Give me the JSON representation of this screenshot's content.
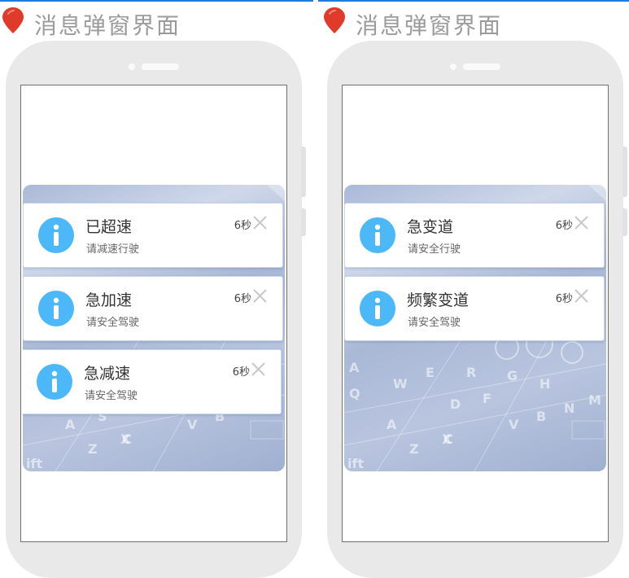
{
  "panels": [
    {
      "title": "消息弹窗界面",
      "notifications": [
        {
          "title": "已超速",
          "message": "请减速行驶",
          "timer": "6秒"
        },
        {
          "title": "急加速",
          "message": "请安全驾驶",
          "timer": "6秒"
        },
        {
          "title": "急减速",
          "message": "请安全驾驶",
          "timer": "6秒"
        }
      ]
    },
    {
      "title": "消息弹窗界面",
      "notifications": [
        {
          "title": "急变道",
          "message": "请安全行驶",
          "timer": "6秒"
        },
        {
          "title": "频繁变道",
          "message": "请安全驾驶",
          "timer": "6秒"
        }
      ]
    }
  ],
  "colors": {
    "accent_bar": "#1e7bd8",
    "pin": "#e03a2b",
    "info_icon": "#4cb8f7",
    "title_text": "#9b9b9b",
    "close_icon": "#c8c8c8"
  },
  "icons": {
    "pin": "map-pin-icon",
    "info": "info-icon",
    "close": "close-icon"
  }
}
